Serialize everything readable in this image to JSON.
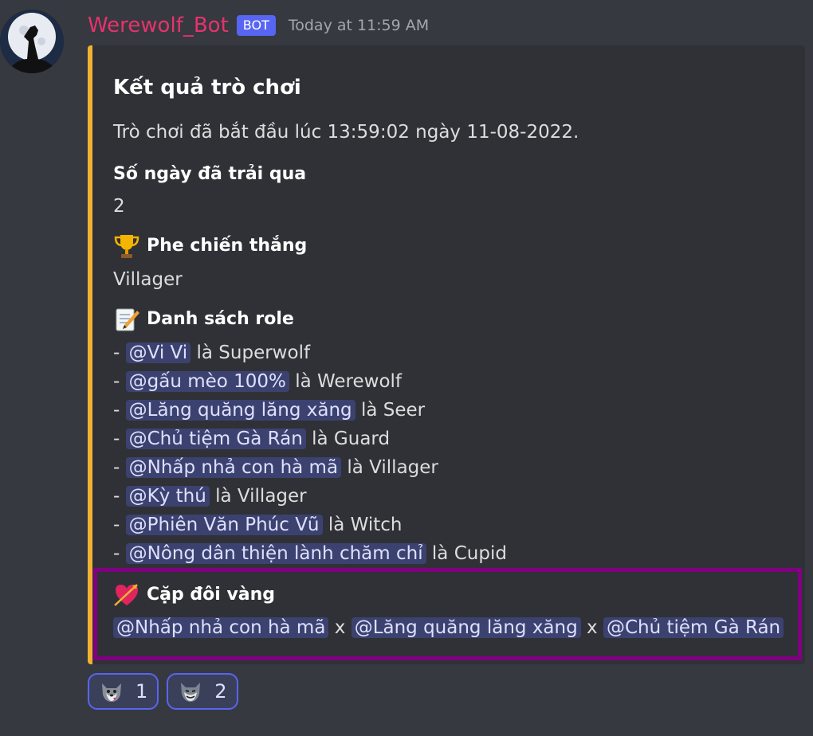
{
  "message": {
    "username": "Werewolf_Bot",
    "bot_badge": "BOT",
    "timestamp": "Today at 11:59 AM"
  },
  "embed": {
    "title": "Kết quả trò chơi",
    "description": "Trò chơi đã bắt đầu lúc 13:59:02 ngày 11-08-2022.",
    "accent_color": "#f0b232",
    "fields": {
      "days": {
        "name": "Số ngày đã trải qua",
        "value": "2"
      },
      "winner": {
        "icon": "trophy-icon",
        "name": "Phe chiến thắng",
        "value": "Villager"
      },
      "roles": {
        "icon": "memo-icon",
        "name": "Danh sách role",
        "connector": "là",
        "items": [
          {
            "mention": "@Vi Vi",
            "role": "Superwolf"
          },
          {
            "mention": "@gấu mèo 100%",
            "role": "Werewolf"
          },
          {
            "mention": "@Lăng quăng lăng xăng",
            "role": "Seer"
          },
          {
            "mention": "@Chủ tiệm Gà Rán",
            "role": "Guard"
          },
          {
            "mention": "@Nhấp nhả con hà mã",
            "role": "Villager"
          },
          {
            "mention": "@Kỳ thú",
            "role": "Villager"
          },
          {
            "mention": "@Phiên Văn Phúc Vũ",
            "role": "Witch"
          },
          {
            "mention": "@Nông dân thiện lành chăm chỉ",
            "role": "Cupid"
          }
        ]
      },
      "couple": {
        "icon": "heart-arrow-icon",
        "name": "Cặp đôi vàng",
        "separator": "x",
        "members": [
          "@Nhấp nhả con hà mã",
          "@Lăng quăng lăng xăng",
          "@Chủ tiệm Gà Rán"
        ]
      }
    }
  },
  "reactions": [
    {
      "icon": "wolf-emoji-1",
      "count": "1"
    },
    {
      "icon": "wolf-emoji-2",
      "count": "2"
    }
  ],
  "colors": {
    "username": "#e8326d",
    "bot_badge": "#5865f2",
    "mention_bg": "#3c4270",
    "highlight_border": "#800080"
  }
}
